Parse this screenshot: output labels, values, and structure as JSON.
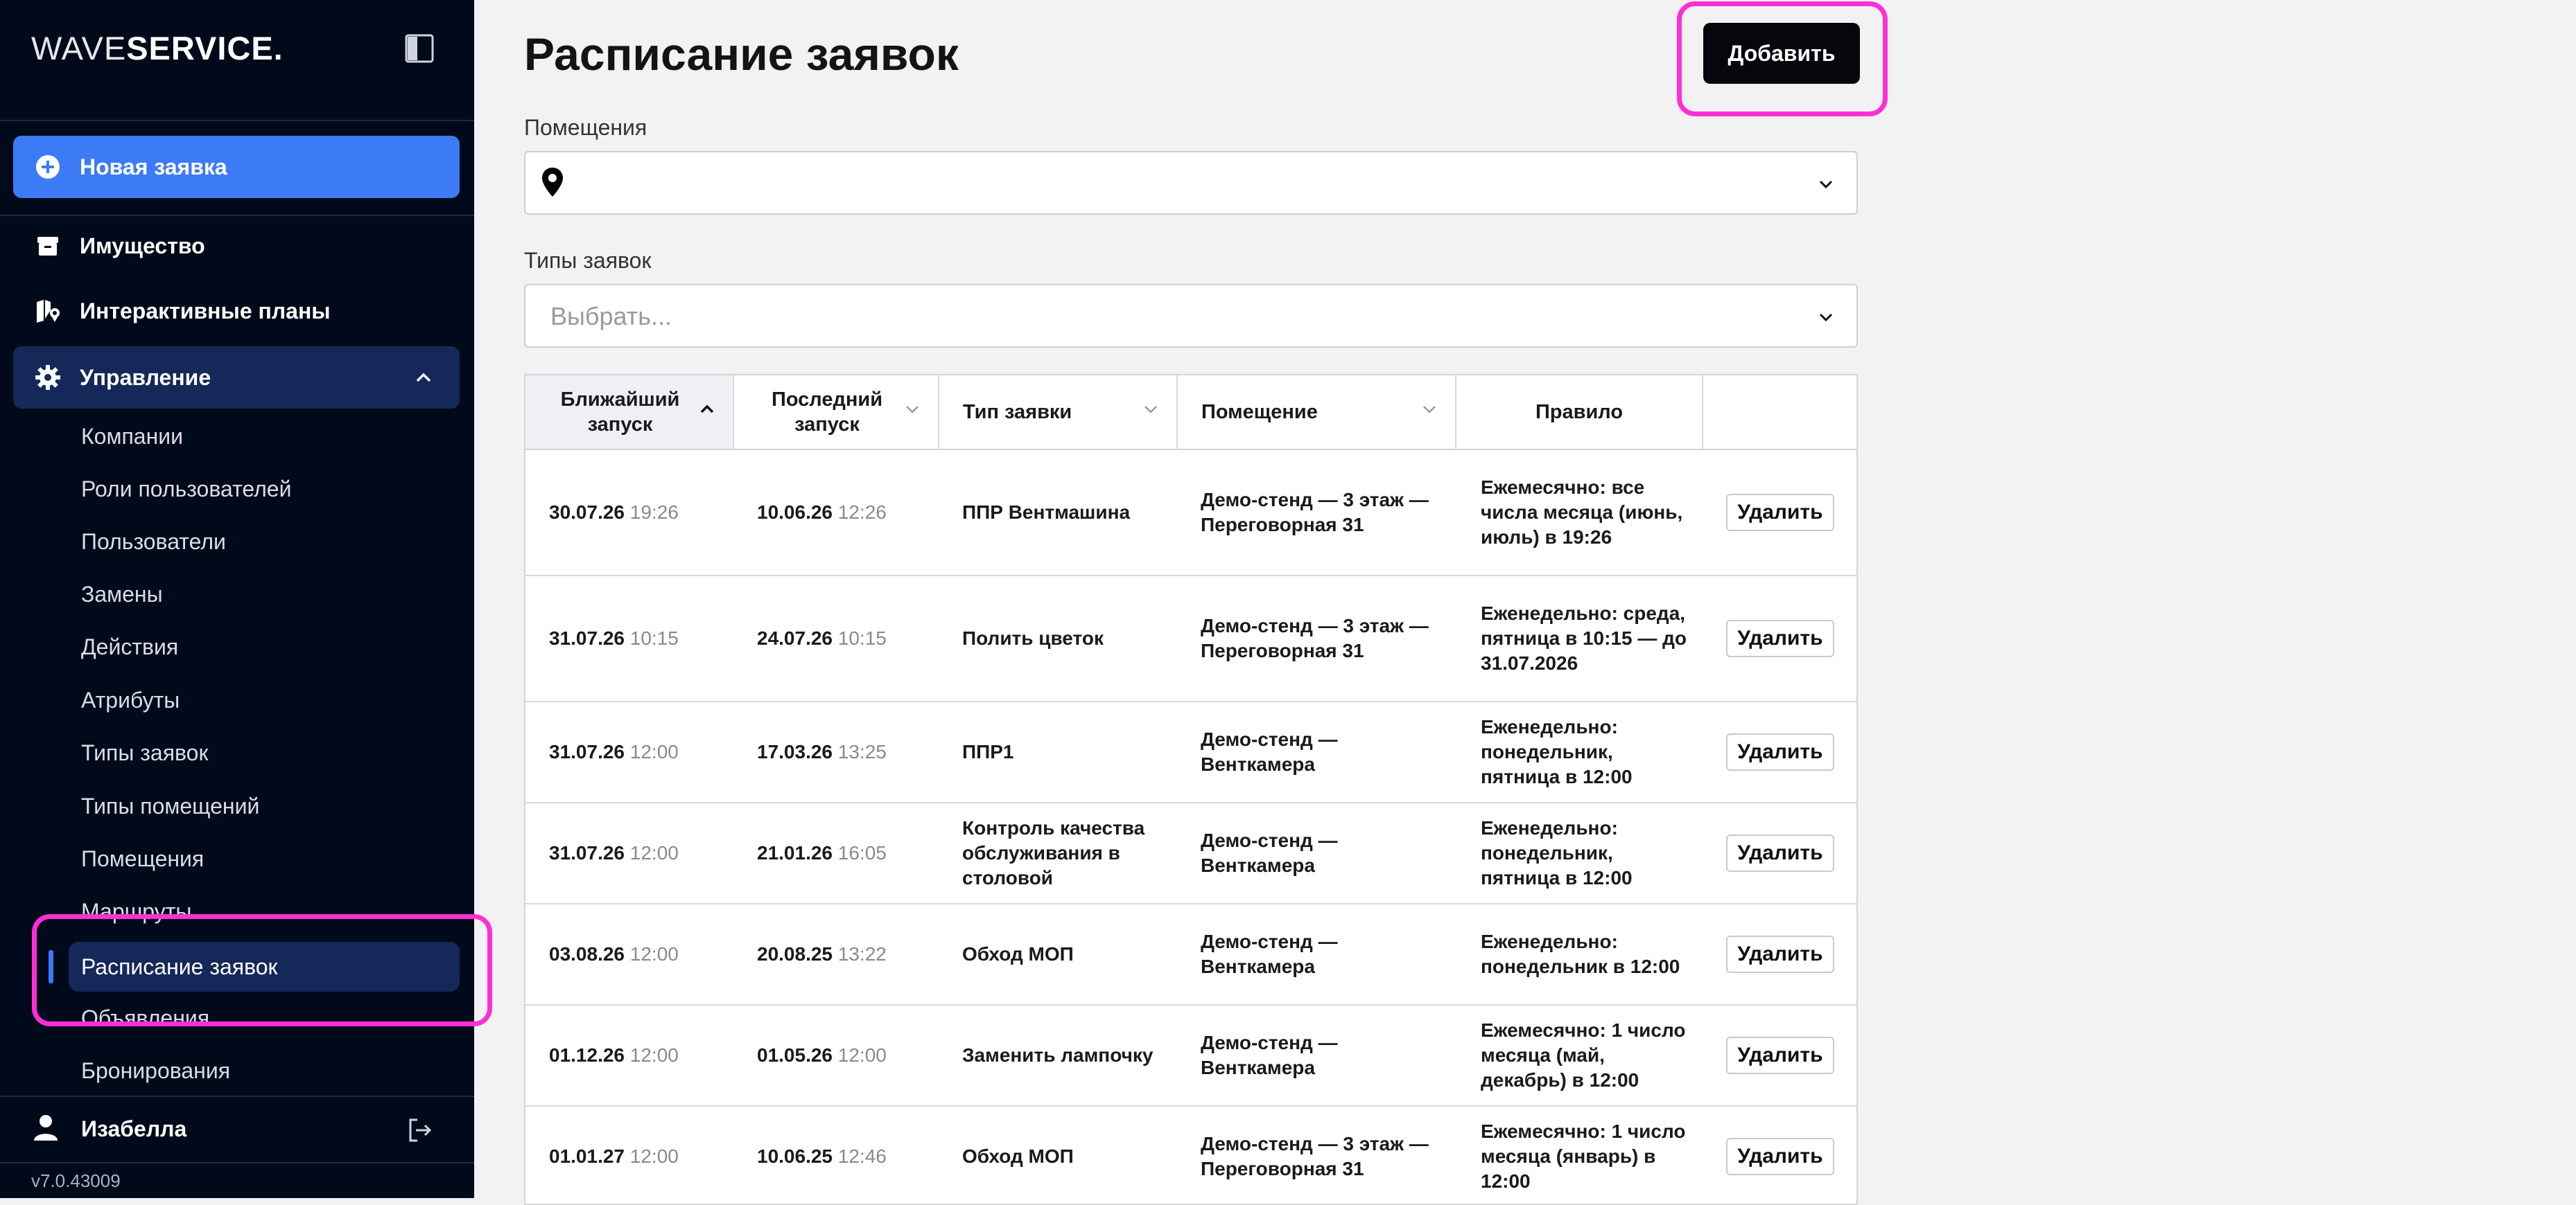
{
  "sidebar": {
    "logo_part1": "WAVE",
    "logo_part2": "SERVICE.",
    "new_request_label": "Новая заявка",
    "items": [
      {
        "label": "Имущество"
      },
      {
        "label": "Интерактивные планы"
      },
      {
        "label": "Управление"
      }
    ],
    "management_subitems": [
      "Компании",
      "Роли пользователей",
      "Пользователи",
      "Замены",
      "Действия",
      "Атрибуты",
      "Типы заявок",
      "Типы помещений",
      "Помещения",
      "Маршруты",
      "Расписание заявок",
      "Объявления",
      "Бронирования"
    ],
    "active_subitem": "Расписание заявок",
    "user_name": "Изабелла",
    "version": "v7.0.43009"
  },
  "main": {
    "title": "Расписание заявок",
    "add_button": "Добавить",
    "filters": {
      "rooms_label": "Помещения",
      "rooms_value": "",
      "types_label": "Типы заявок",
      "types_placeholder": "Выбрать..."
    },
    "table": {
      "headers": [
        "Ближайший запуск",
        "Последний запуск",
        "Тип заявки",
        "Помещение",
        "Правило",
        ""
      ],
      "delete_label": "Удалить",
      "rows": [
        {
          "next_date": "30.07.26",
          "next_time": "19:26",
          "last_date": "10.06.26",
          "last_time": "12:26",
          "type": "ППР Вентмашина",
          "room": "Демо-стенд — 3 этаж — Переговорная 31",
          "rule": "Ежемесячно: все числа месяца (июнь, июль) в 19:26"
        },
        {
          "next_date": "31.07.26",
          "next_time": "10:15",
          "last_date": "24.07.26",
          "last_time": "10:15",
          "type": "Полить цветок",
          "room": "Демо-стенд — 3 этаж — Переговорная 31",
          "rule": "Еженедельно: среда, пятница в 10:15 — до 31.07.2026"
        },
        {
          "next_date": "31.07.26",
          "next_time": "12:00",
          "last_date": "17.03.26",
          "last_time": "13:25",
          "type": "ППР1",
          "room": "Демо-стенд — Венткамера",
          "rule": "Еженедельно: понедельник, пятница в 12:00"
        },
        {
          "next_date": "31.07.26",
          "next_time": "12:00",
          "last_date": "21.01.26",
          "last_time": "16:05",
          "type": "Контроль качества обслуживания в столовой",
          "room": "Демо-стенд — Венткамера",
          "rule": "Еженедельно: понедельник, пятница в 12:00"
        },
        {
          "next_date": "03.08.26",
          "next_time": "12:00",
          "last_date": "20.08.25",
          "last_time": "13:22",
          "type": "Обход МОП",
          "room": "Демо-стенд — Венткамера",
          "rule": "Еженедельно: понедельник в 12:00"
        },
        {
          "next_date": "01.12.26",
          "next_time": "12:00",
          "last_date": "01.05.26",
          "last_time": "12:00",
          "type": "Заменить лампочку",
          "room": "Демо-стенд — Венткамера",
          "rule": "Ежемесячно: 1 число месяца (май, декабрь) в 12:00"
        },
        {
          "next_date": "01.01.27",
          "next_time": "12:00",
          "last_date": "10.06.25",
          "last_time": "12:46",
          "type": "Обход МОП",
          "room": "Демо-стенд — 3 этаж — Переговорная 31",
          "rule": "Ежемесячно: 1 число месяца (январь) в 12:00"
        }
      ]
    }
  },
  "colors": {
    "sidebar_bg": "#000a1a",
    "accent": "#3d7bf6",
    "active_bg": "#15285a",
    "highlight": "#ff2fd5"
  },
  "icons": [
    "collapse-sidebar-icon",
    "plus-circle-icon",
    "archive-box-icon",
    "map-plan-icon",
    "gear-icon",
    "chevron-up-icon",
    "user-icon",
    "logout-icon",
    "location-pin-icon",
    "chevron-down-icon",
    "sort-up-icon",
    "sort-down-icon"
  ]
}
